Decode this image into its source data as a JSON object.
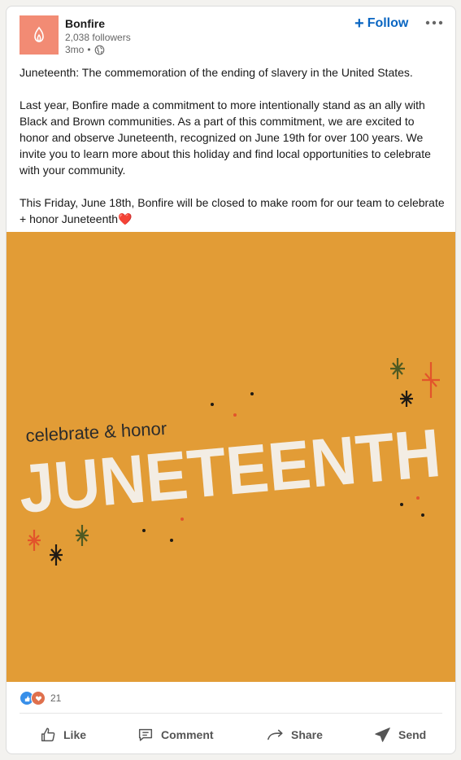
{
  "post": {
    "company_name": "Bonfire",
    "followers": "2,038 followers",
    "age": "3mo",
    "separator": "•",
    "follow_label": "Follow",
    "follow_plus": "+",
    "text": [
      "Juneteenth: The commemoration of the ending of slavery in the United States.",
      "Last year, Bonfire made a commitment to more intentionally stand as an ally with Black and Brown communities. As a part of this commitment, we are excited to honor and observe Juneteenth, recognized on June 19th for over 100 years. We invite you to learn more about this holiday and find local opportunities to celebrate with your community.",
      "This Friday, June 18th, Bonfire will be closed to make room for our team to celebrate + honor Juneteenth❤️"
    ],
    "image": {
      "subtitle": "celebrate & honor",
      "title": "JUNETEENTH",
      "background": "#e29c36"
    }
  },
  "social": {
    "reaction_count": "21",
    "reactions": [
      "like-icon",
      "love-icon"
    ]
  },
  "actions": {
    "like": "Like",
    "comment": "Comment",
    "share": "Share",
    "send": "Send"
  },
  "colors": {
    "accent": "#0a66c2",
    "logo_bg": "#f28b74"
  }
}
